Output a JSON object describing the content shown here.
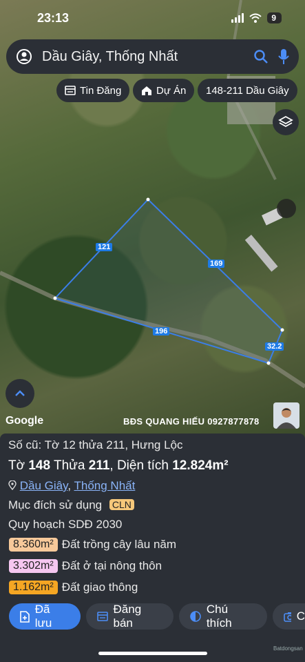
{
  "status_bar": {
    "time": "23:13",
    "battery": "9"
  },
  "search": {
    "query": "Dầu Giây, Thống Nhất"
  },
  "chips": [
    {
      "label": "Tin Đăng",
      "icon": "listing-icon"
    },
    {
      "label": "Dự Án",
      "icon": "project-icon"
    },
    {
      "label": "148-211 Dầu Giây"
    }
  ],
  "map": {
    "edge_labels": {
      "a": "121",
      "b": "169",
      "c": "196",
      "d": "32.2"
    },
    "google": "Google",
    "watermark": "BĐS QUANG HIẾU 0927877878"
  },
  "panel": {
    "old_info": "Số cũ: Tờ 12 thửa 211, Hưng Lộc",
    "to_label": "Tờ",
    "to_value": "148",
    "thua_label": "Thửa",
    "thua_value": "211",
    "area_label": ", Diện tích",
    "area_value": "12.824m²",
    "district": "Dầu Giây",
    "separator": ",",
    "province": "Thống Nhất",
    "purpose_label": "Mục đích sử dụng",
    "purpose_code": "CLN",
    "planning_title": "Quy hoạch SDĐ 2030",
    "legend": [
      {
        "area": "8.360m²",
        "label": "Đất trồng cây lâu năm",
        "color": "#f7c99a"
      },
      {
        "area": "3.302m²",
        "label": "Đất ở tại nông thôn",
        "color": "#f5c6f0"
      },
      {
        "area": "1.162m²",
        "label": "Đất giao thông",
        "color": "#f5a623"
      }
    ]
  },
  "actions": {
    "saved": "Đã lưu",
    "post_sale": "Đăng bán",
    "note": "Chú thích",
    "photo": "C"
  },
  "brand": "Batdongsan"
}
